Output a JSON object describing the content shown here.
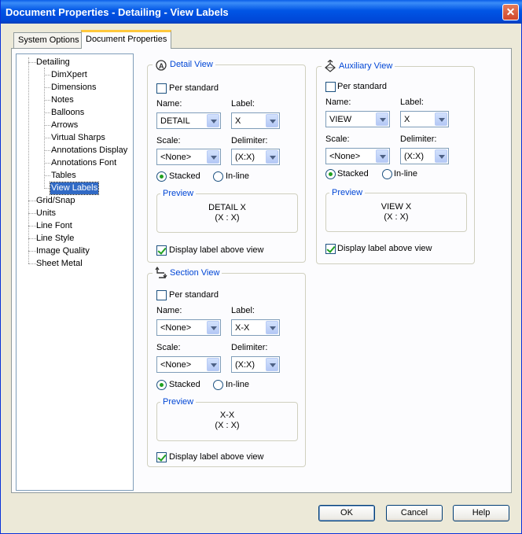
{
  "window": {
    "title": "Document Properties - Detailing - View Labels",
    "close_glyph": "✕"
  },
  "tabs": [
    {
      "label": "System Options",
      "active": false
    },
    {
      "label": "Document Properties",
      "active": true
    }
  ],
  "tree": {
    "root": "Detailing",
    "children": [
      "DimXpert",
      "Dimensions",
      "Notes",
      "Balloons",
      "Arrows",
      "Virtual Sharps",
      "Annotations Display",
      "Annotations Font",
      "Tables",
      "View Labels"
    ],
    "selected": "View Labels",
    "others": [
      "Grid/Snap",
      "Units",
      "Line Font",
      "Line Style",
      "Image Quality",
      "Sheet Metal"
    ]
  },
  "detail_view": {
    "title": "Detail View",
    "icon": "detail-view-icon",
    "per_standard": {
      "label": "Per standard",
      "checked": false
    },
    "name_label": "Name:",
    "name_value": "DETAIL",
    "label_label": "Label:",
    "label_value": "X",
    "scale_label": "Scale:",
    "scale_value": "<None>",
    "delimiter_label": "Delimiter:",
    "delimiter_value": "(X:X)",
    "stacked": {
      "label": "Stacked",
      "checked": true
    },
    "inline": {
      "label": "In-line",
      "checked": false
    },
    "preview_title": "Preview",
    "preview_line1": "DETAIL X",
    "preview_line2": "(X : X)",
    "display_above": {
      "label": "Display label above view",
      "checked": true
    }
  },
  "section_view": {
    "title": "Section View",
    "icon": "section-view-icon",
    "per_standard": {
      "label": "Per standard",
      "checked": false
    },
    "name_label": "Name:",
    "name_value": "<None>",
    "label_label": "Label:",
    "label_value": "X-X",
    "scale_label": "Scale:",
    "scale_value": "<None>",
    "delimiter_label": "Delimiter:",
    "delimiter_value": "(X:X)",
    "stacked": {
      "label": "Stacked",
      "checked": true
    },
    "inline": {
      "label": "In-line",
      "checked": false
    },
    "preview_title": "Preview",
    "preview_line1": "X-X",
    "preview_line2": "(X : X)",
    "display_above": {
      "label": "Display label above view",
      "checked": true
    }
  },
  "auxiliary_view": {
    "title": "Auxiliary View",
    "icon": "auxiliary-view-icon",
    "per_standard": {
      "label": "Per standard",
      "checked": false
    },
    "name_label": "Name:",
    "name_value": "VIEW",
    "label_label": "Label:",
    "label_value": "X",
    "scale_label": "Scale:",
    "scale_value": "<None>",
    "delimiter_label": "Delimiter:",
    "delimiter_value": "(X:X)",
    "stacked": {
      "label": "Stacked",
      "checked": true
    },
    "inline": {
      "label": "In-line",
      "checked": false
    },
    "preview_title": "Preview",
    "preview_line1": "VIEW X",
    "preview_line2": "(X : X)",
    "display_above": {
      "label": "Display label above view",
      "checked": true
    }
  },
  "buttons": {
    "ok": "OK",
    "cancel": "Cancel",
    "help": "Help"
  },
  "colors": {
    "title_bar": "#0054e3",
    "group_title": "#0046d5",
    "selection": "#316ac5",
    "check_mark": "#21a121"
  }
}
